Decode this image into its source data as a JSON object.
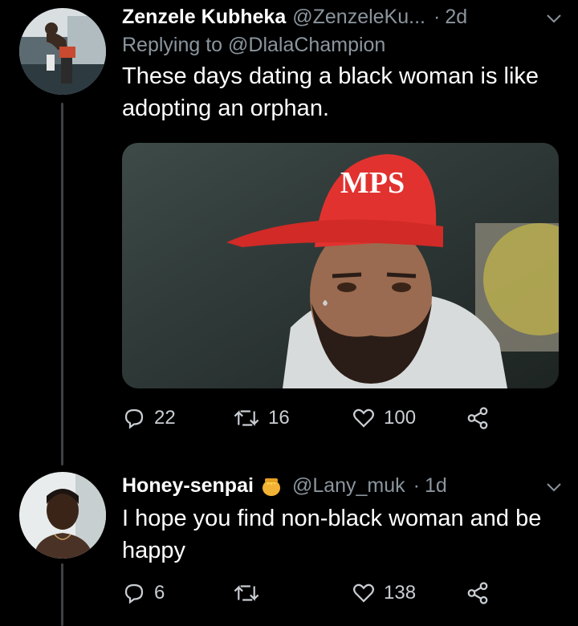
{
  "tweets": [
    {
      "name": "Zenzele Kubheka",
      "handle": "@ZenzeleKu...",
      "time": "2d",
      "reply_prefix": "Replying to",
      "reply_to": "@DlalaChampion",
      "text": "These days dating a black woman is like adopting an orphan.",
      "replies": "22",
      "retweets": "16",
      "likes": "100"
    },
    {
      "name": "Honey-senpai",
      "handle": "@Lany_muk",
      "time": "1d",
      "text": "I hope you find non-black woman and be happy",
      "replies": "6",
      "retweets": "",
      "likes": "138"
    }
  ],
  "image_text": {
    "cap_text": "MPS"
  },
  "colors": {
    "background": "#000000",
    "secondary_text": "#8b959e",
    "cap_red": "#e1322f"
  },
  "icons": [
    "reply-icon",
    "retweet-icon",
    "like-icon",
    "share-icon",
    "chevron-down-icon",
    "honey-pot-icon"
  ]
}
